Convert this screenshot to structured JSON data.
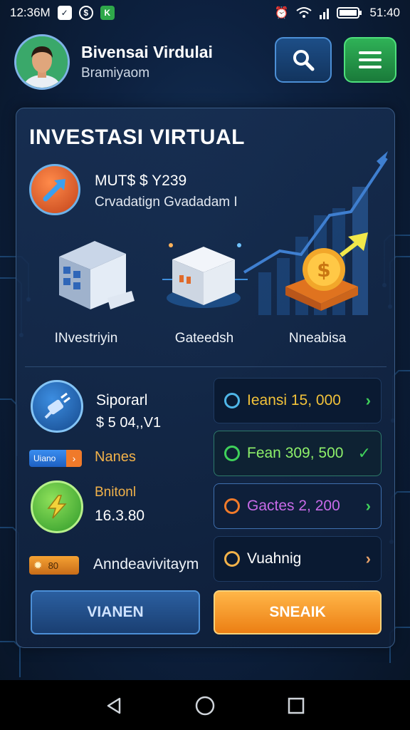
{
  "statusbar": {
    "time_left": "12:36M",
    "time_right": "51:40"
  },
  "header": {
    "title": "Bivensai Virdulai",
    "subtitle": "Bramiyaom"
  },
  "panel": {
    "title": "INVESTASI VIRTUAL",
    "stat_line1": "MUT$ $ Y239",
    "stat_line2": "Crvadatign Gvadadam I",
    "illustrations": [
      {
        "label": "INvestriyin"
      },
      {
        "label": "Gateedsh"
      },
      {
        "label": "Nneabisa"
      }
    ]
  },
  "left": {
    "sponsor_title": "Siporarl",
    "sponsor_value": "$ 5 04,,V1",
    "badge_blue": "Uiano",
    "nanes": "Nanes",
    "bolt_title": "Bnitonl",
    "bolt_value": "16.3.80",
    "badge_gold_num": "80",
    "andea": "Anndeavivitaym"
  },
  "rows": [
    {
      "text": "Ieansi 15, 000",
      "text_color": "#f2c23a",
      "dot_color": "#4fb6e8",
      "chev": "›",
      "chev_color": "#3fd15a"
    },
    {
      "text": "Fean 309, 500",
      "text_color": "#8ef06a",
      "dot_color": "#3fd15a",
      "chev": "✓",
      "chev_color": "#3fd15a"
    },
    {
      "text": "Gactes 2, 200",
      "text_color": "#c86ae8",
      "dot_color": "#f07a2a",
      "chev": "›",
      "chev_color": "#3fd15a"
    },
    {
      "text": "Vuahnig",
      "text_color": "#ffffff",
      "dot_color": "#f2b24a",
      "chev": "›",
      "chev_color": "#e8a26a"
    }
  ],
  "buttons": {
    "left": "VIANEN",
    "right": "SNEAIK"
  },
  "icons": [
    "search-icon",
    "menu-icon",
    "growth-arrow-icon",
    "plug-icon",
    "bolt-icon",
    "star-icon",
    "back-nav-icon",
    "home-nav-icon",
    "recents-nav-icon"
  ]
}
